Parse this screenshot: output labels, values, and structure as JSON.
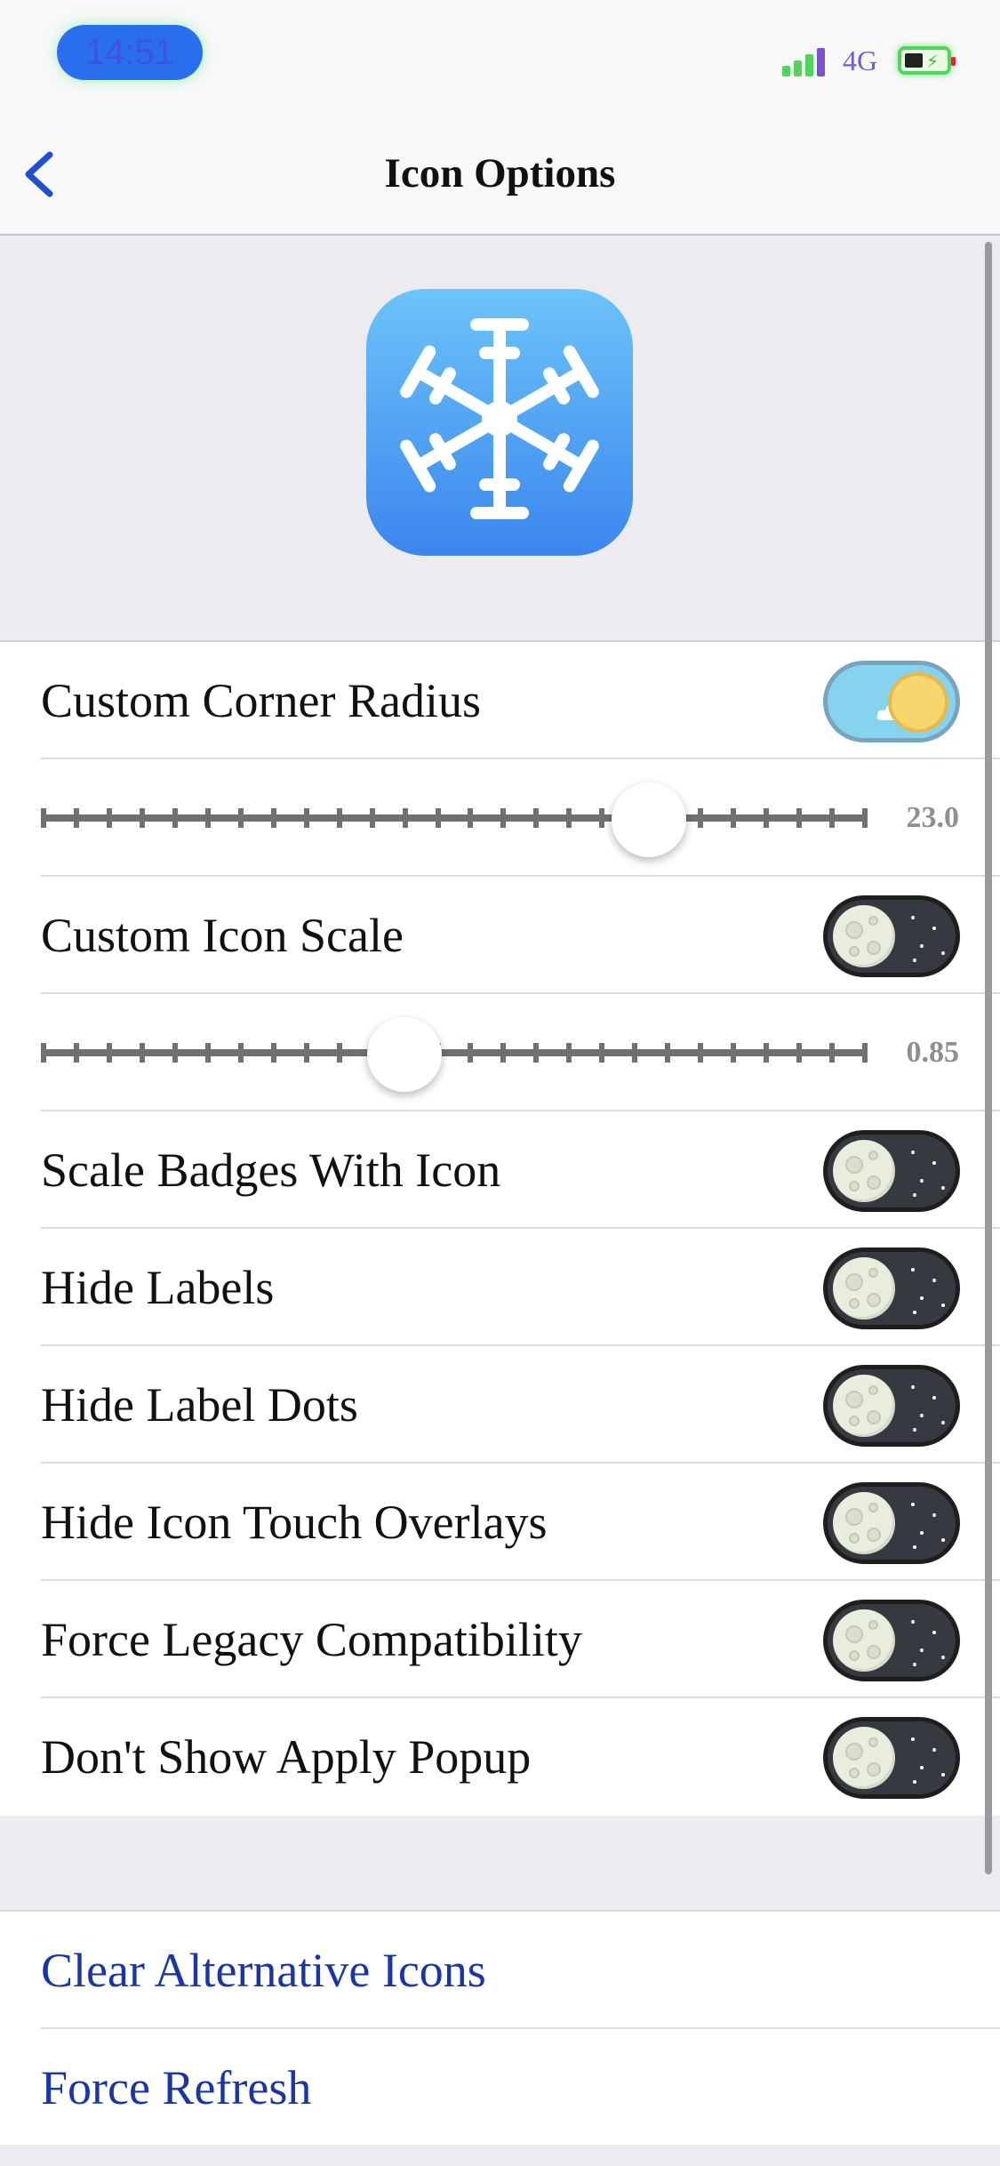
{
  "status_bar": {
    "time": "14:51",
    "network": "4G"
  },
  "nav": {
    "title": "Icon Options"
  },
  "options": [
    {
      "label": "Custom Corner Radius",
      "state": "on",
      "slider_value_text": "23.0",
      "slider_fraction": 0.735
    },
    {
      "label": "Custom Icon Scale",
      "state": "off",
      "slider_value_text": "0.85",
      "slider_fraction": 0.44
    },
    {
      "label": "Scale Badges With Icon",
      "state": "off"
    },
    {
      "label": "Hide Labels",
      "state": "off"
    },
    {
      "label": "Hide Label Dots",
      "state": "off"
    },
    {
      "label": "Hide Icon Touch Overlays",
      "state": "off"
    },
    {
      "label": "Force Legacy Compatibility",
      "state": "off"
    },
    {
      "label": "Don't Show Apply Popup",
      "state": "off"
    }
  ],
  "actions": [
    {
      "label": "Clear Alternative Icons"
    },
    {
      "label": "Force Refresh"
    }
  ],
  "colors": {
    "accent": "#1a35a9",
    "toggle_off": "#363a40",
    "toggle_on": "#86d3f0",
    "icon_top": "#6cc4f8",
    "icon_bottom": "#3b86ee"
  },
  "icons": {
    "back": "chevron-left-icon",
    "app": "snowflake-icon"
  }
}
